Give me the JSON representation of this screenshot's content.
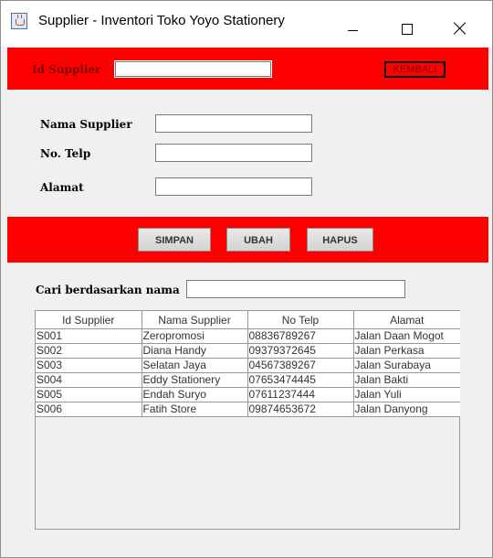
{
  "window": {
    "title": "Supplier - Inventori Toko Yoyo Stationery",
    "app_icon": "java-cup-icon"
  },
  "header": {
    "id_label": "Id Supplier",
    "id_value": "",
    "back_button": "KEMBALI"
  },
  "form": {
    "nama_label": "Nama Supplier",
    "nama_value": "",
    "telp_label": "No. Telp",
    "telp_value": "",
    "alamat_label": "Alamat",
    "alamat_value": ""
  },
  "actions": {
    "save": "SIMPAN",
    "edit": "UBAH",
    "delete": "HAPUS"
  },
  "search": {
    "label": "Cari berdasarkan nama",
    "value": ""
  },
  "table": {
    "columns": [
      "Id Supplier",
      "Nama Supplier",
      "No Telp",
      "Alamat"
    ],
    "rows": [
      [
        "S001",
        "Zeropromosi",
        "08836789267",
        "Jalan Daan Mogot"
      ],
      [
        "S002",
        "Diana Handy",
        "09379372645",
        "Jalan Perkasa"
      ],
      [
        "S003",
        "Selatan Jaya",
        "04567389267",
        "Jalan Surabaya"
      ],
      [
        "S004",
        "Eddy Stationery",
        "07653474445",
        "Jalan Bakti"
      ],
      [
        "S005",
        "Endah Suryo",
        "07611237444",
        "Jalan Yuli"
      ],
      [
        "S006",
        "Fatih Store",
        "09874653672",
        "Jalan Danyong"
      ]
    ]
  },
  "colors": {
    "band": "#ff0000",
    "window_bg": "#f0f0f0"
  }
}
